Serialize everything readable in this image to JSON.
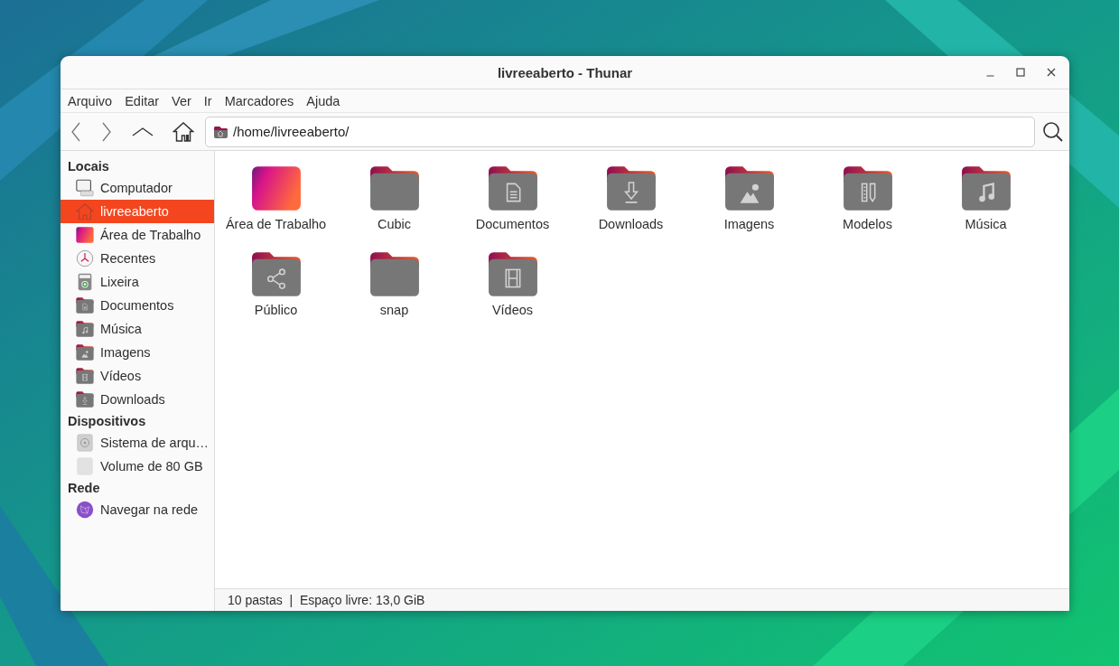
{
  "window": {
    "title": "livreeaberto - Thunar"
  },
  "menu": [
    "Arquivo",
    "Editar",
    "Ver",
    "Ir",
    "Marcadores",
    "Ajuda"
  ],
  "location": {
    "path": "/home/livreeaberto/"
  },
  "sidebar": {
    "sections": [
      {
        "title": "Locais",
        "items": [
          {
            "label": "Computador",
            "kind": "computer",
            "selected": false
          },
          {
            "label": "livreeaberto",
            "kind": "home",
            "selected": true
          },
          {
            "label": "Área de Trabalho",
            "kind": "desktop",
            "selected": false
          },
          {
            "label": "Recentes",
            "kind": "recent",
            "selected": false
          },
          {
            "label": "Lixeira",
            "kind": "trash",
            "selected": false
          },
          {
            "label": "Documentos",
            "kind": "documents",
            "selected": false
          },
          {
            "label": "Música",
            "kind": "music",
            "selected": false
          },
          {
            "label": "Imagens",
            "kind": "pictures",
            "selected": false
          },
          {
            "label": "Vídeos",
            "kind": "videos",
            "selected": false
          },
          {
            "label": "Downloads",
            "kind": "downloads",
            "selected": false
          }
        ]
      },
      {
        "title": "Dispositivos",
        "items": [
          {
            "label": "Sistema de arqu…",
            "kind": "drive",
            "selected": false
          },
          {
            "label": "Volume de 80 GB",
            "kind": "volume",
            "selected": false
          }
        ]
      },
      {
        "title": "Rede",
        "items": [
          {
            "label": "Navegar na rede",
            "kind": "network",
            "selected": false
          }
        ]
      }
    ]
  },
  "files": [
    {
      "name": "Área de Trabalho",
      "kind": "desktop"
    },
    {
      "name": "Cubic",
      "kind": "plain"
    },
    {
      "name": "Documentos",
      "kind": "documents"
    },
    {
      "name": "Downloads",
      "kind": "downloads"
    },
    {
      "name": "Imagens",
      "kind": "pictures"
    },
    {
      "name": "Modelos",
      "kind": "templates"
    },
    {
      "name": "Música",
      "kind": "music"
    },
    {
      "name": "Público",
      "kind": "public"
    },
    {
      "name": "snap",
      "kind": "plain"
    },
    {
      "name": "Vídeos",
      "kind": "videos"
    }
  ],
  "status_bar": "10 pastas  |  Espaço livre: 13,0 GiB"
}
